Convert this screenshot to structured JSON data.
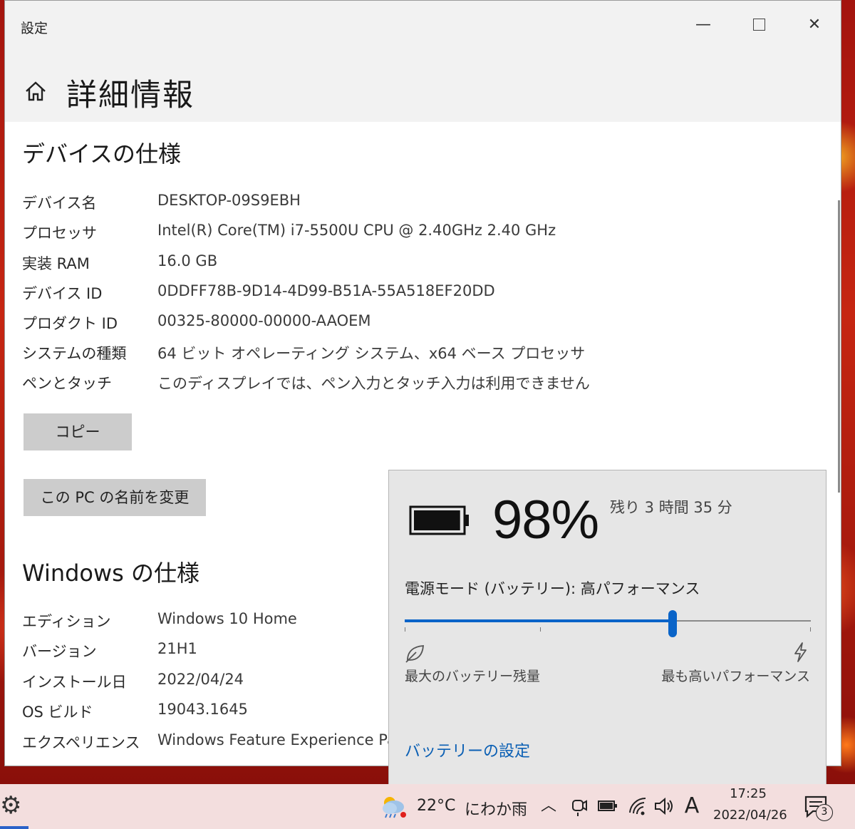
{
  "window": {
    "title": "設定",
    "minimize": "—",
    "close": "✕"
  },
  "header": {
    "title": "詳細情報"
  },
  "device_spec": {
    "title": "デバイスの仕様",
    "rows": [
      {
        "label": "デバイス名",
        "value": "DESKTOP-09S9EBH"
      },
      {
        "label": "プロセッサ",
        "value": "Intel(R) Core(TM) i7-5500U CPU @ 2.40GHz   2.40 GHz"
      },
      {
        "label": "実装 RAM",
        "value": "16.0 GB"
      },
      {
        "label": "デバイス ID",
        "value": "0DDFF78B-9D14-4D99-B51A-55A518EF20DD"
      },
      {
        "label": "プロダクト ID",
        "value": "00325-80000-00000-AAOEM"
      },
      {
        "label": "システムの種類",
        "value": "64 ビット オペレーティング システム、x64 ベース プロセッサ"
      },
      {
        "label": "ペンとタッチ",
        "value": "このディスプレイでは、ペン入力とタッチ入力は利用できません"
      }
    ],
    "copy_button": "コピー",
    "rename_button": "この PC の名前を変更"
  },
  "windows_spec": {
    "title": "Windows の仕様",
    "rows": [
      {
        "label": "エディション",
        "value": "Windows 10 Home"
      },
      {
        "label": "バージョン",
        "value": "21H1"
      },
      {
        "label": "インストール日",
        "value": "2022/04/24"
      },
      {
        "label": "OS ビルド",
        "value": "19043.1645"
      },
      {
        "label": "エクスペリエンス",
        "value": "Windows Feature Experience Pa"
      }
    ]
  },
  "battery_flyout": {
    "percent": "98%",
    "level": 0.98,
    "remaining": "残り 3 時間 35 分",
    "power_mode": "電源モード (バッテリー): 高パフォーマンス",
    "slider_level": 0.66,
    "min_label": "最大のバッテリー残量",
    "max_label": "最も高いパフォーマンス",
    "settings_link": "バッテリーの設定",
    "accent_color": "#0a64c8"
  },
  "taskbar": {
    "temperature": "22°C",
    "condition": "にわか雨",
    "ime": "A",
    "time": "17:25",
    "date": "2022/04/26",
    "notification_count": "3",
    "icons": [
      "settings-gear-icon",
      "weather-icon",
      "chevron-up-icon",
      "meet-now-icon",
      "battery-icon",
      "wifi-icon",
      "speaker-icon",
      "notification-icon"
    ]
  }
}
